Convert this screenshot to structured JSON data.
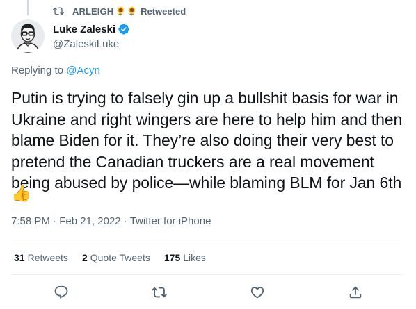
{
  "retweeted_by": {
    "name": "ARLEIGH",
    "emoji": [
      "🌻",
      "🌻"
    ],
    "label": "Retweeted"
  },
  "author": {
    "name": "Luke Zaleski",
    "handle": "@ZaleskiLuke",
    "verified": true
  },
  "replying": {
    "prefix": "Replying to ",
    "mention": "@Acyn"
  },
  "tweet": {
    "text": "Putin is trying to falsely gin up a bullshit basis for war in Ukraine and right wingers are here to help him and then blame Biden for it. They’re also doing their very best to pretend the Canadian truckers are a real movement being abused by police—while blaming BLM for Jan 6th",
    "emoji": "👍",
    "time": "7:58 PM",
    "date": "Feb 21, 2022",
    "source": "Twitter for iPhone",
    "separator": "·"
  },
  "stats": {
    "retweets_count": "31",
    "retweets_label": "Retweets",
    "quotes_count": "2",
    "quotes_label": "Quote Tweets",
    "likes_count": "175",
    "likes_label": "Likes"
  },
  "icons": {
    "retweet_header": "retweet-icon",
    "verified": "verified-badge-icon",
    "reply": "reply-icon",
    "retweet": "retweet-icon",
    "like": "heart-icon",
    "share": "share-icon"
  },
  "colors": {
    "accent": "#1d9bf0",
    "text": "#0f1419",
    "secondary": "#536471",
    "divider": "#eff3f4"
  }
}
